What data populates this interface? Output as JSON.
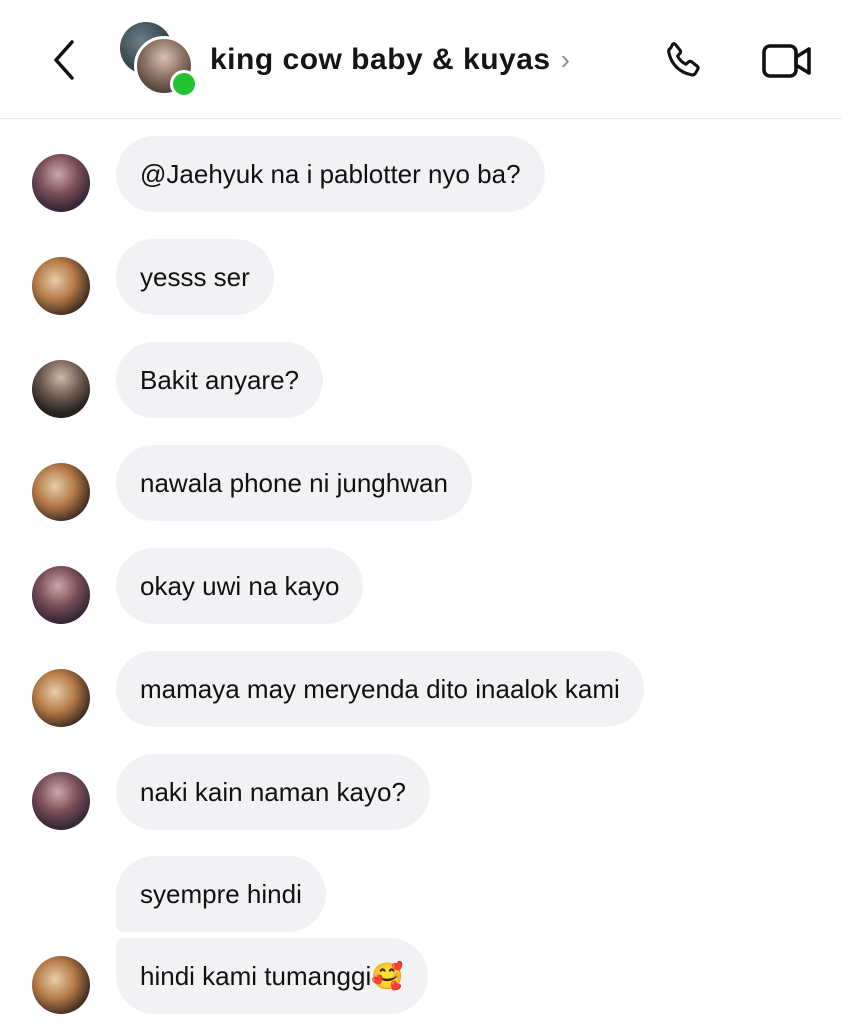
{
  "header": {
    "back_icon": "chevron-left-icon",
    "title": "king cow baby & kuyas",
    "title_chevron": "›",
    "call_icon": "phone-icon",
    "video_icon": "video-camera-icon",
    "online_color": "#22c32e"
  },
  "messages": [
    {
      "avatar": "a",
      "text": "@Jaehyuk na i pablotter nyo ba?"
    },
    {
      "avatar": "b",
      "text": "yesss ser"
    },
    {
      "avatar": "c",
      "text": "Bakit anyare?"
    },
    {
      "avatar": "b",
      "text": "nawala phone ni junghwan"
    },
    {
      "avatar": "a",
      "text": "okay uwi na kayo"
    },
    {
      "avatar": "b",
      "text": "mamaya may meryenda dito inaalok kami"
    },
    {
      "avatar": "a",
      "text": "naki kain naman kayo?"
    },
    {
      "avatar": "",
      "text": "syempre hindi"
    },
    {
      "avatar": "b",
      "text": "hindi kami tumanggi🥰"
    }
  ],
  "colors": {
    "bubble_bg": "#f2f2f5",
    "divider": "#e9e9ec"
  }
}
